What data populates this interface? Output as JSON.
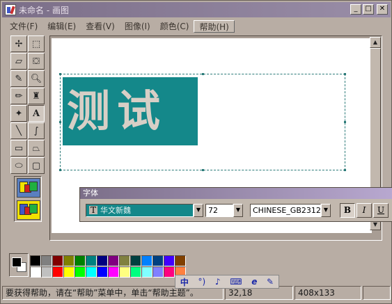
{
  "window": {
    "title": "未命名 - 画图"
  },
  "menubar": {
    "items": [
      "文件(F)",
      "编辑(E)",
      "查看(V)",
      "图像(I)",
      "颜色(C)",
      "帮助(H)"
    ]
  },
  "tools": [
    {
      "name": "free-select-icon",
      "glyph": "✢"
    },
    {
      "name": "rect-select-icon",
      "glyph": "⬚"
    },
    {
      "name": "eraser-icon",
      "glyph": "▱"
    },
    {
      "name": "fill-bucket-icon",
      "glyph": "⛋"
    },
    {
      "name": "color-picker-icon",
      "glyph": "✎"
    },
    {
      "name": "magnifier-icon",
      "glyph": "🔍︎"
    },
    {
      "name": "pencil-icon",
      "glyph": "✏"
    },
    {
      "name": "brush-icon",
      "glyph": "♜"
    },
    {
      "name": "airbrush-icon",
      "glyph": "✦"
    },
    {
      "name": "text-tool-icon",
      "glyph": "A"
    },
    {
      "name": "line-icon",
      "glyph": "╲"
    },
    {
      "name": "curve-icon",
      "glyph": "∫"
    },
    {
      "name": "rectangle-icon",
      "glyph": "▭"
    },
    {
      "name": "polygon-icon",
      "glyph": "⏢"
    },
    {
      "name": "ellipse-icon",
      "glyph": "⬭"
    },
    {
      "name": "rounded-rect-icon",
      "glyph": "▢"
    }
  ],
  "canvas": {
    "text": "测试"
  },
  "fontbar": {
    "title": "字体",
    "font_name": "华文新魏",
    "font_size": "72",
    "charset": "CHINESE_GB2312",
    "bold": "B",
    "italic": "I",
    "underline": "U"
  },
  "palette": {
    "colors": [
      "#000000",
      "#808080",
      "#800000",
      "#808000",
      "#008000",
      "#008080",
      "#000080",
      "#800080",
      "#808040",
      "#004040",
      "#0080ff",
      "#004080",
      "#4000ff",
      "#804000",
      "#ffffff",
      "#c0c0c0",
      "#ff0000",
      "#ffff00",
      "#00ff00",
      "#00ffff",
      "#0000ff",
      "#ff00ff",
      "#ffff80",
      "#00ff80",
      "#80ffff",
      "#8080ff",
      "#ff0080",
      "#ff8040"
    ]
  },
  "ime": {
    "mode": "中",
    "items": [
      "°)",
      "♪",
      "⌨",
      "e",
      "✎"
    ]
  },
  "status": {
    "help": "要获得帮助，请在“帮助”菜单中，单击“帮助主题”。",
    "coords": "32,18",
    "size": "408x133"
  }
}
